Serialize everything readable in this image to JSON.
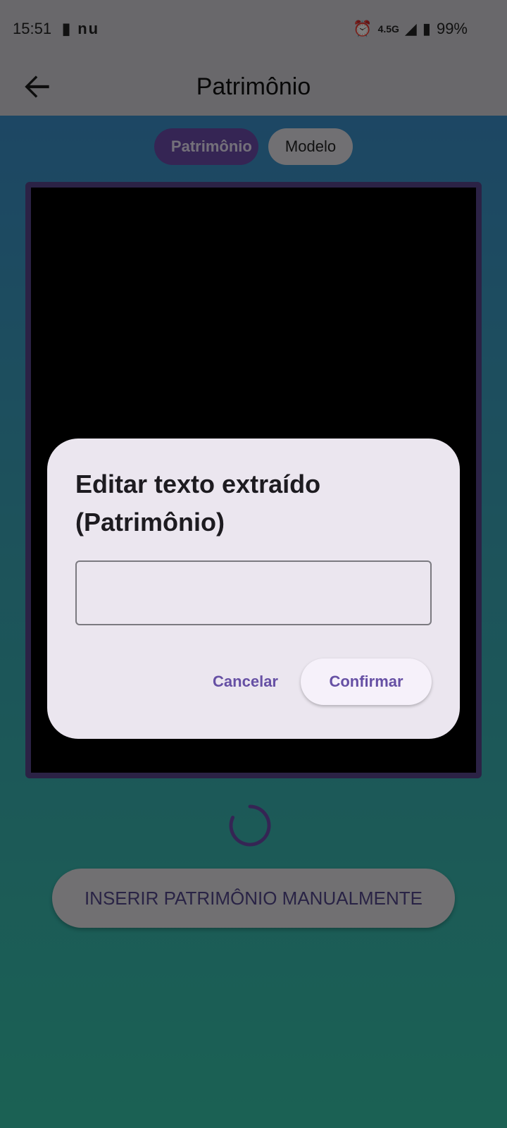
{
  "status_bar": {
    "time": "15:51",
    "left_icons": [
      "sim-card-icon",
      "nubank-icon"
    ],
    "left_text": "nu",
    "network": "4.5G",
    "battery": "99%"
  },
  "app_bar": {
    "title": "Patrimônio",
    "back_icon": "arrow-left-icon"
  },
  "tabs": [
    {
      "label": "Patrimônio",
      "active": true
    },
    {
      "label": "Modelo",
      "active": false
    }
  ],
  "manual_button": {
    "label": "INSERIR PATRIMÔNIO MANUALMENTE"
  },
  "dialog": {
    "title": "Editar texto extraído (Patrimônio)",
    "input_value": "",
    "cancel_label": "Cancelar",
    "confirm_label": "Confirmar"
  },
  "colors": {
    "accent": "#6650a4",
    "tab_active": "#6a4aa8",
    "camera_border": "#57448a"
  }
}
